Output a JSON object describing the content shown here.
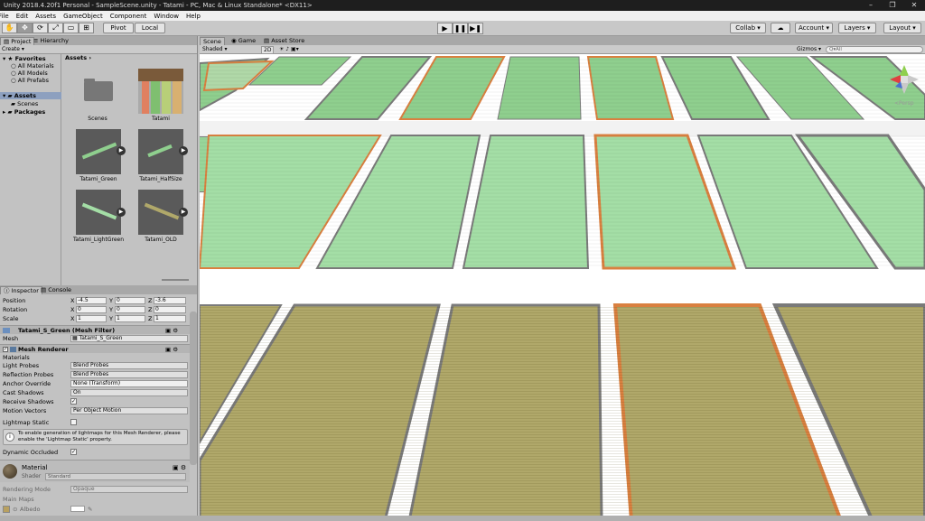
{
  "window": {
    "title": "Unity 2018.4.20f1 Personal - SampleScene.unity - Tatami - PC, Mac & Linux Standalone* <DX11>",
    "controls": [
      "–",
      "❐",
      "✕"
    ]
  },
  "menu": [
    "File",
    "Edit",
    "Assets",
    "GameObject",
    "Component",
    "Window",
    "Help"
  ],
  "toolbar": {
    "tools": [
      "✋",
      "✥",
      "⟳",
      "⤢",
      "▭",
      "⊞"
    ],
    "pivot": "Pivot",
    "local": "Local",
    "play": [
      "▶",
      "❚❚",
      "▶❚"
    ],
    "collab": "Collab ▾",
    "cloud": "☁",
    "account": "Account ▾",
    "layers": "Layers ▾",
    "layout": "Layout ▾"
  },
  "project": {
    "tab_project": "Project",
    "tab_hierarchy": "Hierarchy",
    "create": "Create ▾",
    "favorites": "Favorites",
    "fav_items": [
      "All Materials",
      "All Models",
      "All Prefabs"
    ],
    "assets": "Assets",
    "scenes": "Scenes",
    "packages": "Packages",
    "breadcrumb": "Assets ›",
    "items": [
      "Scenes",
      "Tatami",
      "Tatami_Green",
      "Tatami_HalfSize",
      "Tatami_LightGreen",
      "Tatami_OLD"
    ]
  },
  "inspector": {
    "tab_inspector": "Inspector",
    "tab_console": "Console",
    "position": {
      "label": "Position",
      "x": "-4.5",
      "y": "0",
      "z": "-3.6"
    },
    "rotation": {
      "label": "Rotation",
      "x": "0",
      "y": "0",
      "z": "0"
    },
    "scale": {
      "label": "Scale",
      "x": "1",
      "y": "1",
      "z": "1"
    },
    "mesh_filter_header": "Tatami_S_Green (Mesh Filter)",
    "mesh_label": "Mesh",
    "mesh_value": "Tatami_S_Green",
    "mesh_renderer_header": "Mesh Renderer",
    "materials": "Materials",
    "light_probes_label": "Light Probes",
    "light_probes": "Blend Probes",
    "reflection_probes_label": "Reflection Probes",
    "reflection_probes": "Blend Probes",
    "anchor_override_label": "Anchor Override",
    "anchor_override": "None (Transform)",
    "cast_shadows_label": "Cast Shadows",
    "cast_shadows": "On",
    "receive_shadows_label": "Receive Shadows",
    "motion_vectors_label": "Motion Vectors",
    "motion_vectors": "Per Object Motion",
    "lightmap_static_label": "Lightmap Static",
    "info": "To enable generation of lightmaps for this Mesh Renderer, please enable the 'Lightmap Static' property.",
    "dynamic_occluded_label": "Dynamic Occluded",
    "material_label": "Material",
    "shader_label": "Shader",
    "shader": "Standard",
    "rendering_mode_label": "Rendering Mode",
    "rendering_mode": "Opaque",
    "main_maps": "Main Maps",
    "albedo": "Albedo"
  },
  "scene": {
    "tab_scene": "Scene",
    "tab_game": "Game",
    "tab_store": "Asset Store",
    "shaded": "Shaded ▾",
    "twod": "2D",
    "gizmos": "Gizmos ▾",
    "search": "Q▾All",
    "persp": "<Persp"
  },
  "colors": {
    "green": "#8fcf8e",
    "light_green": "#a4dea6",
    "old": "#b0a86a",
    "border_orange": "#d98040",
    "border_gray": "#7a7a7a",
    "selected": "#8da0bf"
  }
}
